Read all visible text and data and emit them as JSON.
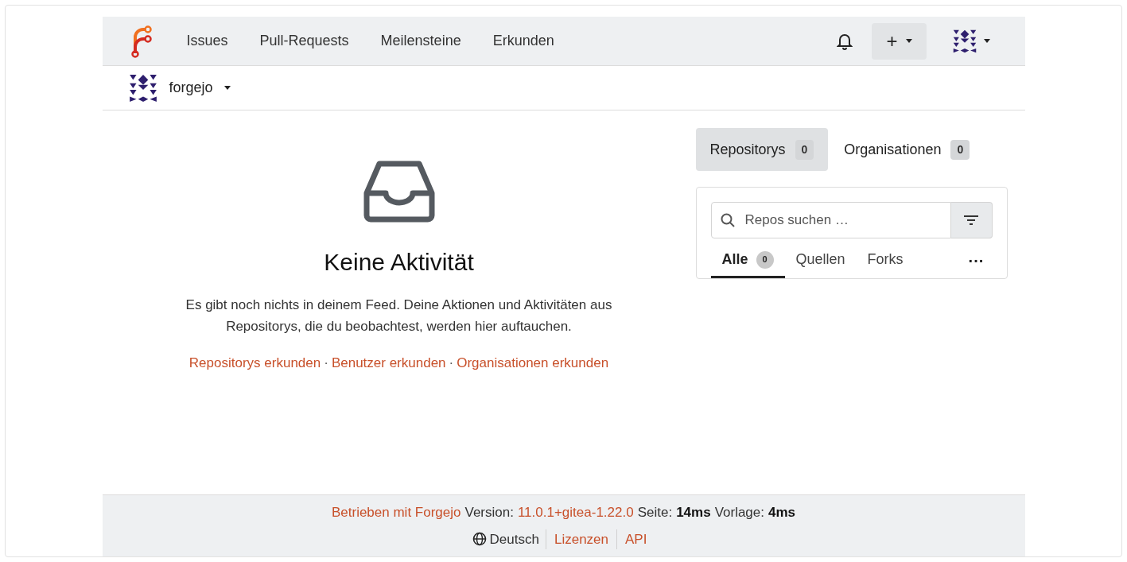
{
  "navbar": {
    "items": [
      {
        "label": "Issues"
      },
      {
        "label": "Pull-Requests"
      },
      {
        "label": "Meilensteine"
      },
      {
        "label": "Erkunden"
      }
    ],
    "create_button": "+"
  },
  "context": {
    "name": "forgejo"
  },
  "feed": {
    "title": "Keine Aktivität",
    "message": "Es gibt noch nichts in deinem Feed. Deine Aktionen und Aktivitäten aus Repositorys, die du beobachtest, werden hier auftauchen.",
    "links": [
      {
        "label": "Repositorys erkunden"
      },
      {
        "label": "Benutzer erkunden"
      },
      {
        "label": "Organisationen erkunden"
      }
    ],
    "separator": "·"
  },
  "side_tabs": [
    {
      "label": "Repositorys",
      "count": "0",
      "selected": true
    },
    {
      "label": "Organisationen",
      "count": "0",
      "selected": false
    }
  ],
  "repo_search": {
    "placeholder": "Repos suchen …"
  },
  "filter_tabs": [
    {
      "label": "Alle",
      "count": "0",
      "selected": true
    },
    {
      "label": "Quellen",
      "selected": false
    },
    {
      "label": "Forks",
      "selected": false
    }
  ],
  "more_menu": "···",
  "footer": {
    "powered": "Betrieben mit Forgejo",
    "version_label": "Version:",
    "version": "11.0.1+gitea-1.22.0",
    "page_label": "Seite:",
    "page_time": "14ms",
    "template_label": "Vorlage:",
    "template_time": "4ms",
    "language": "Deutsch",
    "links": [
      "Lizenzen",
      "API"
    ]
  }
}
